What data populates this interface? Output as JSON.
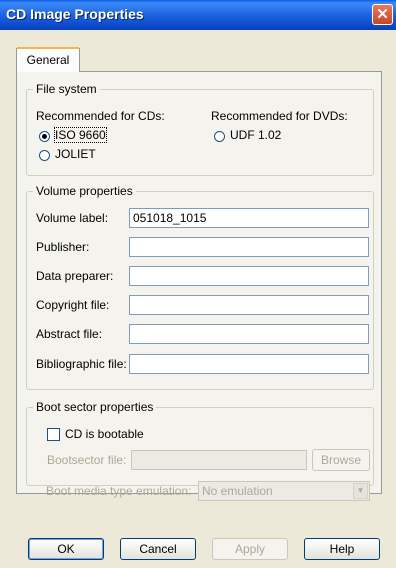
{
  "window": {
    "title": "CD Image Properties",
    "close_icon": "close-icon"
  },
  "tabs": [
    {
      "label": "General",
      "selected": true
    }
  ],
  "file_system": {
    "legend": "File system",
    "cds_heading": "Recommended for CDs:",
    "dvds_heading": "Recommended for DVDs:",
    "options": [
      {
        "label": "ISO 9660",
        "selected": true
      },
      {
        "label": "JOLIET",
        "selected": false
      },
      {
        "label": "UDF 1.02",
        "selected": false
      }
    ]
  },
  "volume": {
    "legend": "Volume properties",
    "fields": [
      {
        "label": "Volume label:",
        "value": "051018_1015"
      },
      {
        "label": "Publisher:",
        "value": ""
      },
      {
        "label": "Data preparer:",
        "value": ""
      },
      {
        "label": "Copyright file:",
        "value": ""
      },
      {
        "label": "Abstract file:",
        "value": ""
      },
      {
        "label": "Bibliographic file:",
        "value": ""
      }
    ]
  },
  "boot": {
    "legend": "Boot sector properties",
    "bootable_label": "CD is bootable",
    "bootable_checked": false,
    "bootsector_label": "Bootsector file:",
    "bootsector_value": "",
    "browse_label": "Browse",
    "emulation_label": "Boot media type emulation:",
    "emulation_value": "No emulation"
  },
  "buttons": {
    "ok": "OK",
    "cancel": "Cancel",
    "apply": "Apply",
    "help": "Help"
  }
}
